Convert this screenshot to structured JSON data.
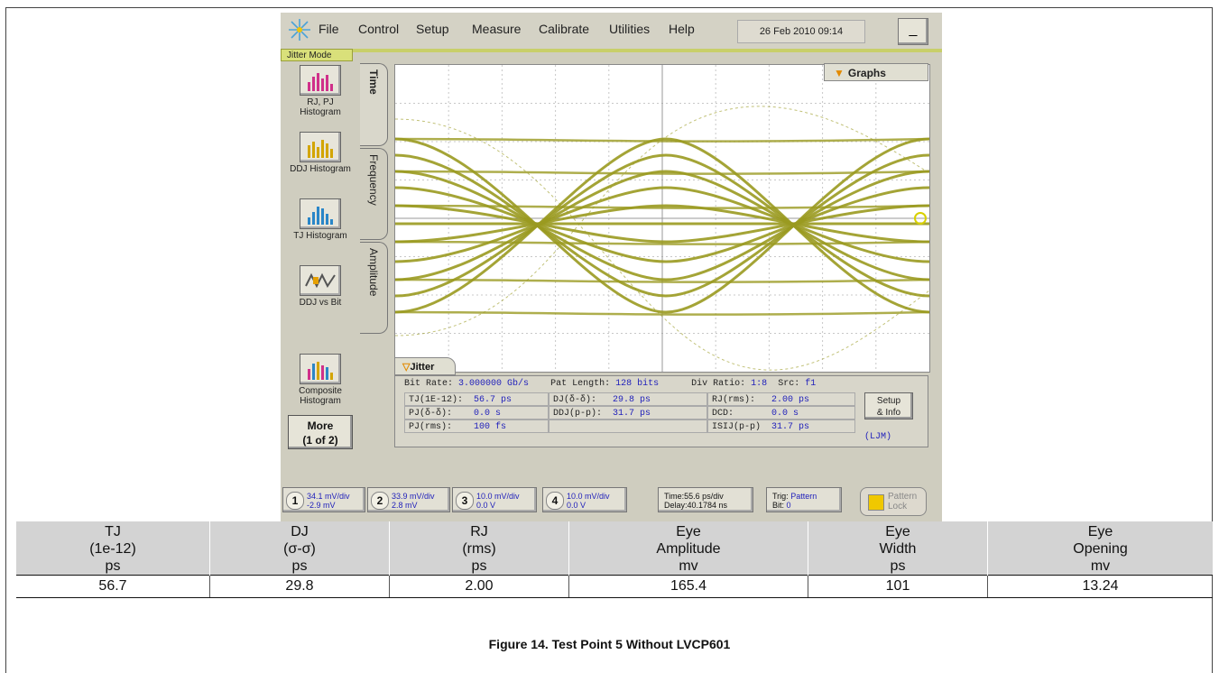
{
  "menubar": {
    "items": [
      {
        "label": "File"
      },
      {
        "label": "Control"
      },
      {
        "label": "Setup"
      },
      {
        "label": "Measure"
      },
      {
        "label": "Calibrate"
      },
      {
        "label": "Utilities"
      },
      {
        "label": "Help"
      }
    ],
    "datetime": "26 Feb 2010  09:14",
    "minimize_label": "_"
  },
  "mode_label": "Jitter Mode",
  "side_buttons": [
    {
      "label": "RJ, PJ Histogram"
    },
    {
      "label": "DDJ Histogram"
    },
    {
      "label": "TJ Histogram"
    },
    {
      "label": "DDJ vs Bit"
    },
    {
      "label": "Composite Histogram"
    }
  ],
  "more_button": {
    "line1": "More",
    "line2": "(1 of 2)"
  },
  "tabs": [
    {
      "label": "Time",
      "active": true
    },
    {
      "label": "Frequency",
      "active": false
    },
    {
      "label": "Amplitude",
      "active": false
    }
  ],
  "graphs_label": "Graphs",
  "jitter_tab_label": "Jitter",
  "jitter": {
    "bit_rate_label": "Bit Rate:",
    "bit_rate": "3.000000 Gb/s",
    "pat_length_label": "Pat Length:",
    "pat_length": "128 bits",
    "div_ratio_label": "Div Ratio:",
    "div_ratio": "1:8",
    "src_label": "Src:",
    "src": "f1",
    "tj_label": "TJ(1E-12):",
    "tj": "56.7 ps",
    "dj_label": "DJ(δ-δ):",
    "dj": "29.8 ps",
    "rj_label": "RJ(rms):",
    "rj": "2.00 ps",
    "pj_label": "PJ(δ-δ):",
    "pj": "0.0 s",
    "ddj_label": "DDJ(p-p):",
    "ddj": "31.7 ps",
    "dcd_label": "DCD:",
    "dcd": "0.0 s",
    "pjrms_label": "PJ(rms):",
    "pjrms": "100 fs",
    "isij_label": "ISIJ(p-p)",
    "isij": "31.7 ps",
    "setup_line1": "Setup",
    "setup_line2": "& Info",
    "ljm": "(LJM)"
  },
  "channels": [
    {
      "num": "1",
      "scale": "34.1 mV/div",
      "offset": "-2.9 mV"
    },
    {
      "num": "2",
      "scale": "33.9 mV/div",
      "offset": "2.8 mV"
    },
    {
      "num": "3",
      "scale": "10.0 mV/div",
      "offset": "0.0 V"
    },
    {
      "num": "4",
      "scale": "10.0 mV/div",
      "offset": "0.0 V"
    }
  ],
  "timebase": {
    "line1": "Time:55.6 ps/div",
    "line2": "Delay:40.1784 ns"
  },
  "trigger": {
    "line1_label": "Trig:",
    "line1_value": "Pattern",
    "line2_label": "Bit:",
    "line2_value": "0"
  },
  "pattern_lock": {
    "line1": "Pattern",
    "line2": "Lock"
  },
  "results_table": {
    "headers": [
      [
        "TJ",
        "(1e-12)",
        "ps"
      ],
      [
        "DJ",
        "(σ-σ)",
        "ps"
      ],
      [
        "RJ",
        "(rms)",
        "ps"
      ],
      [
        "Eye",
        "Amplitude",
        "mv"
      ],
      [
        "Eye",
        "Width",
        "ps"
      ],
      [
        "Eye",
        "Opening",
        "mv"
      ]
    ],
    "values": [
      "56.7",
      "29.8",
      "2.00",
      "165.4",
      "101",
      "13.24"
    ]
  },
  "caption": "Figure 14. Test Point 5 Without LVCP601",
  "colors": {
    "trace": "#9a9a20",
    "scope_bg": "#cfcdbf",
    "value_blue": "#2222bb"
  }
}
